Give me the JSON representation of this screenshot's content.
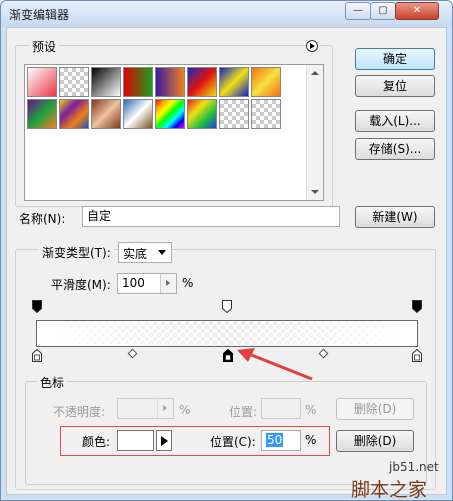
{
  "window": {
    "title": "渐变编辑器",
    "minimize_glyph": "—",
    "maximize_glyph": "▢",
    "close_glyph": "✕"
  },
  "presets": {
    "label": "预设",
    "menu_icon": "circle-arrow-right-icon",
    "swatches": [
      {
        "name": "fg-to-bg",
        "bg": "linear-gradient(135deg,#ffffff,#e8364a)"
      },
      {
        "name": "fg-to-transparent",
        "bg": "checker"
      },
      {
        "name": "black-white",
        "bg": "linear-gradient(135deg,#000,#fff)"
      },
      {
        "name": "red-green",
        "bg": "linear-gradient(90deg,#e00000,#1a9f1a)"
      },
      {
        "name": "violet-orange",
        "bg": "linear-gradient(90deg,#3a1aa0,#f08020)"
      },
      {
        "name": "blue-red-yellow",
        "bg": "linear-gradient(135deg,#1430c0,#e01010,#f0e010)"
      },
      {
        "name": "blue-yellow-blue",
        "bg": "linear-gradient(135deg,#1020d0,#f0e010,#1020d0)"
      },
      {
        "name": "orange-yellow-orange",
        "bg": "linear-gradient(135deg,#f07010,#f8e040,#f07010)"
      },
      {
        "name": "violet-green-orange",
        "bg": "linear-gradient(135deg,#6a1090,#20a040,#f08020)"
      },
      {
        "name": "yellow-violet-orange-blue",
        "bg": "linear-gradient(135deg,#f0d010,#7a20a0,#f08010,#2050c0)"
      },
      {
        "name": "copper",
        "bg": "linear-gradient(135deg,#7a3a1a,#f0c0a0,#7a3a1a)"
      },
      {
        "name": "chrome",
        "bg": "linear-gradient(135deg,#2a6ab0,#fff,#7a5020)"
      },
      {
        "name": "spectrum",
        "bg": "linear-gradient(135deg,red,orange,yellow,lime,cyan,blue,magenta)"
      },
      {
        "name": "transparent-rainbow",
        "bg": "linear-gradient(135deg,#e02020,#f0e010,#20c040,#2040e0)"
      },
      {
        "name": "transparent-stripes",
        "bg": "checker"
      },
      {
        "name": "neutral-density",
        "bg": "checker"
      }
    ]
  },
  "buttons": {
    "ok": "确定",
    "reset": "复位",
    "load": "载入(L)...",
    "save": "存储(S)...",
    "new": "新建(W)",
    "delete_opacity": "删除(D)",
    "delete_color": "删除(D)"
  },
  "name_field": {
    "label": "名称(N):",
    "value": "自定"
  },
  "gradient": {
    "type_label": "渐变类型(T):",
    "type_value": "实底",
    "smoothness_label": "平滑度(M):",
    "smoothness_value": "100",
    "smoothness_unit": "%"
  },
  "stops": {
    "group_label": "色标",
    "opacity_label": "不透明度:",
    "opacity_unit": "%",
    "opacity_location_label": "位置:",
    "opacity_location_unit": "%",
    "color_label": "颜色:",
    "color_value": "#ffffff",
    "color_location_label": "位置(C):",
    "color_location_value": "50",
    "color_location_unit": "%"
  },
  "watermark": {
    "site": "jb51.net",
    "brand": "脚本之家"
  },
  "colors": {
    "accent": "#3c7fb1",
    "highlight_box": "#e24a4a",
    "arrow": "#e04040"
  }
}
